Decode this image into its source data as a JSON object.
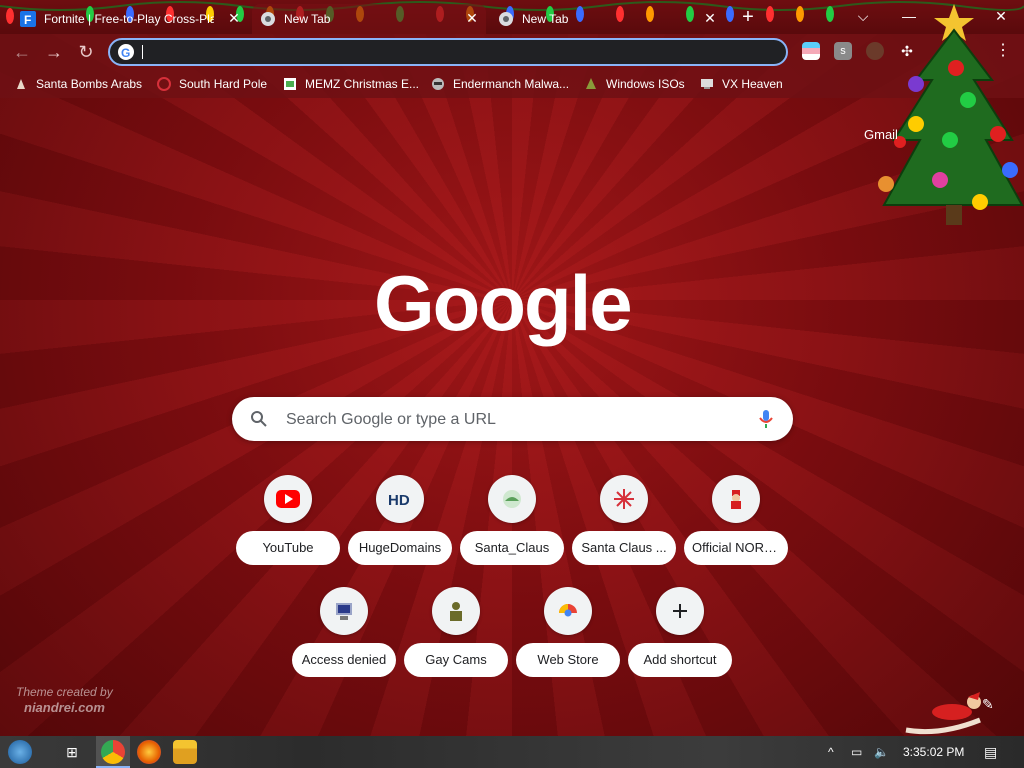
{
  "tabs": [
    {
      "title": "Fortnite | Free-to-Play Cross-Plat",
      "favicon": "fortnite-icon"
    },
    {
      "title": "New Tab",
      "favicon": "chrome-icon",
      "active": true
    },
    {
      "title": "New Tab",
      "favicon": "chrome-icon"
    }
  ],
  "omnibox": {
    "value": "",
    "placeholder": ""
  },
  "bookmarks": [
    {
      "label": "Santa Bombs Arabs",
      "icon": "bookmark-icon"
    },
    {
      "label": "South Hard Pole",
      "icon": "snowflake-icon"
    },
    {
      "label": "MEMZ Christmas E...",
      "icon": "page-icon"
    },
    {
      "label": "Endermanch Malwa...",
      "icon": "raccoon-icon"
    },
    {
      "label": "Windows ISOs",
      "icon": "tree-icon"
    },
    {
      "label": "VX Heaven",
      "icon": "computer-icon"
    }
  ],
  "header": {
    "gmail": "Gmail"
  },
  "search": {
    "placeholder": "Search Google or type a URL"
  },
  "shortcuts": [
    {
      "label": "YouTube",
      "icon": "youtube-icon"
    },
    {
      "label": "HugeDomains",
      "icon": "hd-icon"
    },
    {
      "label": "Santa_Claus",
      "icon": "santa-claus-icon"
    },
    {
      "label": "Santa Claus ...",
      "icon": "snowflake-icon"
    },
    {
      "label": "Official NORA...",
      "icon": "santa-icon"
    },
    {
      "label": "Access denied",
      "icon": "computer-icon"
    },
    {
      "label": "Gay Cams",
      "icon": "people-icon"
    },
    {
      "label": "Web Store",
      "icon": "webstore-icon"
    },
    {
      "label": "Add shortcut",
      "icon": "plus-icon"
    }
  ],
  "credit": {
    "line1": "Theme created by",
    "line2": "niandrei.com"
  },
  "taskbar": {
    "time": "3:35:02 PM"
  },
  "colors": {
    "accent": "#8ab4f8",
    "background": "#7a0d10",
    "youtube": "#ff0000"
  }
}
